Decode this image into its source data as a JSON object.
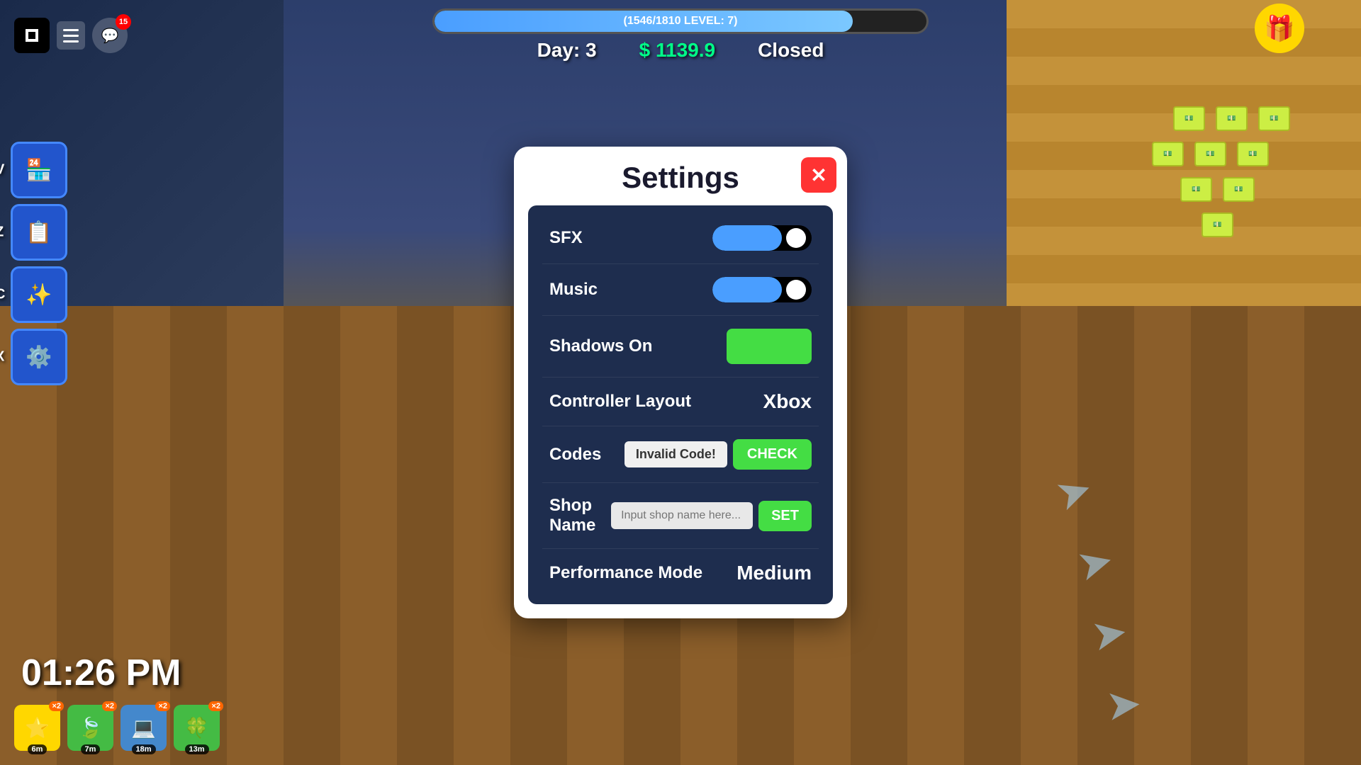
{
  "app": {
    "roblox_icon": "⬛",
    "chat_badge": "15"
  },
  "top_bar": {
    "xp_text": "(1546/1810 LEVEL: 7)",
    "xp_percent": 85,
    "day_label": "Day: 3",
    "money_label": "$ 1139.9",
    "status_label": "Closed"
  },
  "gift": {
    "icon": "🎁"
  },
  "sidebar": {
    "btn1_icon": "🏪",
    "btn1_hotkey": "V",
    "btn2_icon": "📋",
    "btn2_hotkey": "Z",
    "btn3_icon": "✨",
    "btn3_hotkey": "C",
    "btn4_icon": "⚙️",
    "btn4_hotkey": "X"
  },
  "hud": {
    "time": "01:26 PM"
  },
  "bottom_icons": [
    {
      "icon": "⭐",
      "multiplier": "×2",
      "timer": "6m",
      "bg": "#FFD700"
    },
    {
      "icon": "🍃",
      "multiplier": "×2",
      "timer": "7m",
      "bg": "#44bb44"
    },
    {
      "icon": "💻",
      "multiplier": "×2",
      "timer": "18m",
      "bg": "#4488cc"
    },
    {
      "icon": "🍀",
      "multiplier": "×2",
      "timer": "13m",
      "bg": "#44bb44"
    }
  ],
  "settings": {
    "title": "Settings",
    "close_icon": "✕",
    "rows": {
      "sfx_label": "SFX",
      "music_label": "Music",
      "shadows_label": "Shadows On",
      "controller_label": "Controller Layout",
      "controller_value": "Xbox",
      "codes_label": "Codes",
      "codes_invalid": "Invalid Code!",
      "check_btn": "CHECK",
      "shop_name_label": "Shop Name",
      "shop_name_placeholder": "Input shop name here...",
      "set_btn": "SET",
      "performance_label": "Performance Mode",
      "performance_value": "Medium"
    }
  }
}
